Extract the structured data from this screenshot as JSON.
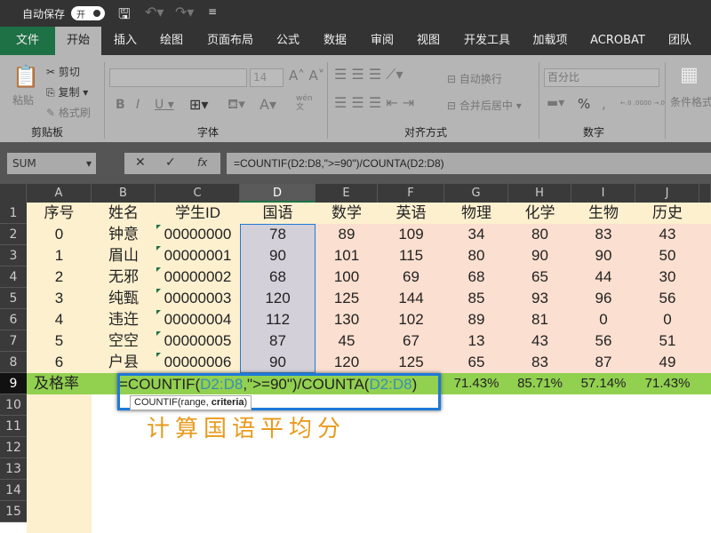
{
  "titlebar": {
    "autosave": "自动保存",
    "toggle": "开"
  },
  "tabs": [
    "文件",
    "开始",
    "插入",
    "绘图",
    "页面布局",
    "公式",
    "数据",
    "审阅",
    "视图",
    "开发工具",
    "加载项",
    "ACROBAT",
    "团队"
  ],
  "ribbon": {
    "paste": "粘贴",
    "cut": "剪切",
    "copy": "复制",
    "format_painter": "格式刷",
    "clipboard": "剪贴板",
    "font_size": "14",
    "font_group": "字体",
    "wen": "wén\n文",
    "wrap": "自动换行",
    "merge": "合并后居中",
    "align_group": "对齐方式",
    "number_format": "百分比",
    "percent": "%",
    "comma": ",",
    "inc_dec": "←.0 .00",
    "dec_dec": ".00 →.0",
    "number_group": "数字",
    "cond_format": "条件格式"
  },
  "formula_bar": {
    "name_box": "SUM",
    "cancel": "✕",
    "enter": "✓",
    "fx": "fx",
    "formula": "=COUNTIF(D2:D8,\">=90\")/COUNTA(D2:D8)"
  },
  "columns": [
    "A",
    "B",
    "C",
    "D",
    "E",
    "F",
    "G",
    "H",
    "I",
    "J"
  ],
  "rows": [
    [
      "序号",
      "姓名",
      "学生ID",
      "国语",
      "数学",
      "英语",
      "物理",
      "化学",
      "生物",
      "历史"
    ],
    [
      "0",
      "钟意",
      "00000000",
      "78",
      "89",
      "109",
      "34",
      "80",
      "83",
      "43"
    ],
    [
      "1",
      "眉山",
      "00000001",
      "90",
      "101",
      "115",
      "80",
      "90",
      "90",
      "50"
    ],
    [
      "2",
      "无邪",
      "00000002",
      "68",
      "100",
      "69",
      "68",
      "65",
      "44",
      "30"
    ],
    [
      "3",
      "纯甄",
      "00000003",
      "120",
      "125",
      "144",
      "85",
      "93",
      "96",
      "56"
    ],
    [
      "4",
      "违迕",
      "00000004",
      "112",
      "130",
      "102",
      "89",
      "81",
      "0",
      "0"
    ],
    [
      "5",
      "空空",
      "00000005",
      "87",
      "45",
      "67",
      "13",
      "43",
      "56",
      "51"
    ],
    [
      "6",
      "户县",
      "00000006",
      "90",
      "120",
      "125",
      "65",
      "83",
      "87",
      "49"
    ]
  ],
  "row9": {
    "label": "及格率",
    "edit_parts": [
      "=COUNTIF(",
      "D2:D8",
      ",\">=90\")/COUNTA(",
      "D2:D8",
      ")"
    ],
    "values": [
      "71.43%",
      "85.71%",
      "57.14%",
      "71.43%"
    ],
    "tooltip_fn": "COUNTIF(range, ",
    "tooltip_arg": "criteria",
    "tooltip_close": ")"
  },
  "row_numbers": [
    "1",
    "2",
    "3",
    "4",
    "5",
    "6",
    "7",
    "8",
    "9",
    "10",
    "11",
    "12",
    "13",
    "14",
    "15"
  ],
  "annotation": "计算国语平均分",
  "colors": {
    "green": "#92d050",
    "cream": "#fdf0cf",
    "peach": "#fbdfd0",
    "selected": "#d4d0da",
    "accent": "#1e7145",
    "edit_border": "#1e7ad8"
  }
}
